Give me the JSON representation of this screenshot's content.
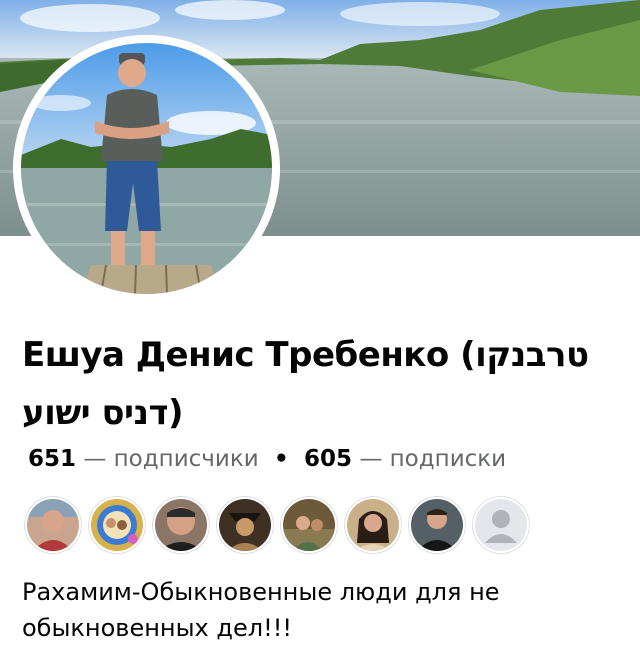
{
  "profile": {
    "name": "Ешуа Денис Требенко (טרבנקו דניס ישוע)",
    "followers_count": "651",
    "followers_label": "— подписчики",
    "separator": "•",
    "following_count": "605",
    "following_label": "— подписки",
    "bio": "Рахамим-Обыкновенные люди для не обыкновенных дел!!!"
  },
  "mutual_friends": [
    {
      "name": "friend-avatar-1",
      "bg": "#c9a590"
    },
    {
      "name": "friend-avatar-2",
      "bg": "#d7b24a"
    },
    {
      "name": "friend-avatar-3",
      "bg": "#8a7566"
    },
    {
      "name": "friend-avatar-4",
      "bg": "#3e3022"
    },
    {
      "name": "friend-avatar-5",
      "bg": "#6d5a3a"
    },
    {
      "name": "friend-avatar-6",
      "bg": "#c9b089"
    },
    {
      "name": "friend-avatar-7",
      "bg": "#556066"
    },
    {
      "name": "friend-avatar-8",
      "bg": "#e4e6eb"
    }
  ],
  "colors": {
    "text_primary": "#050505",
    "text_secondary": "#65676b",
    "background": "#ffffff"
  }
}
